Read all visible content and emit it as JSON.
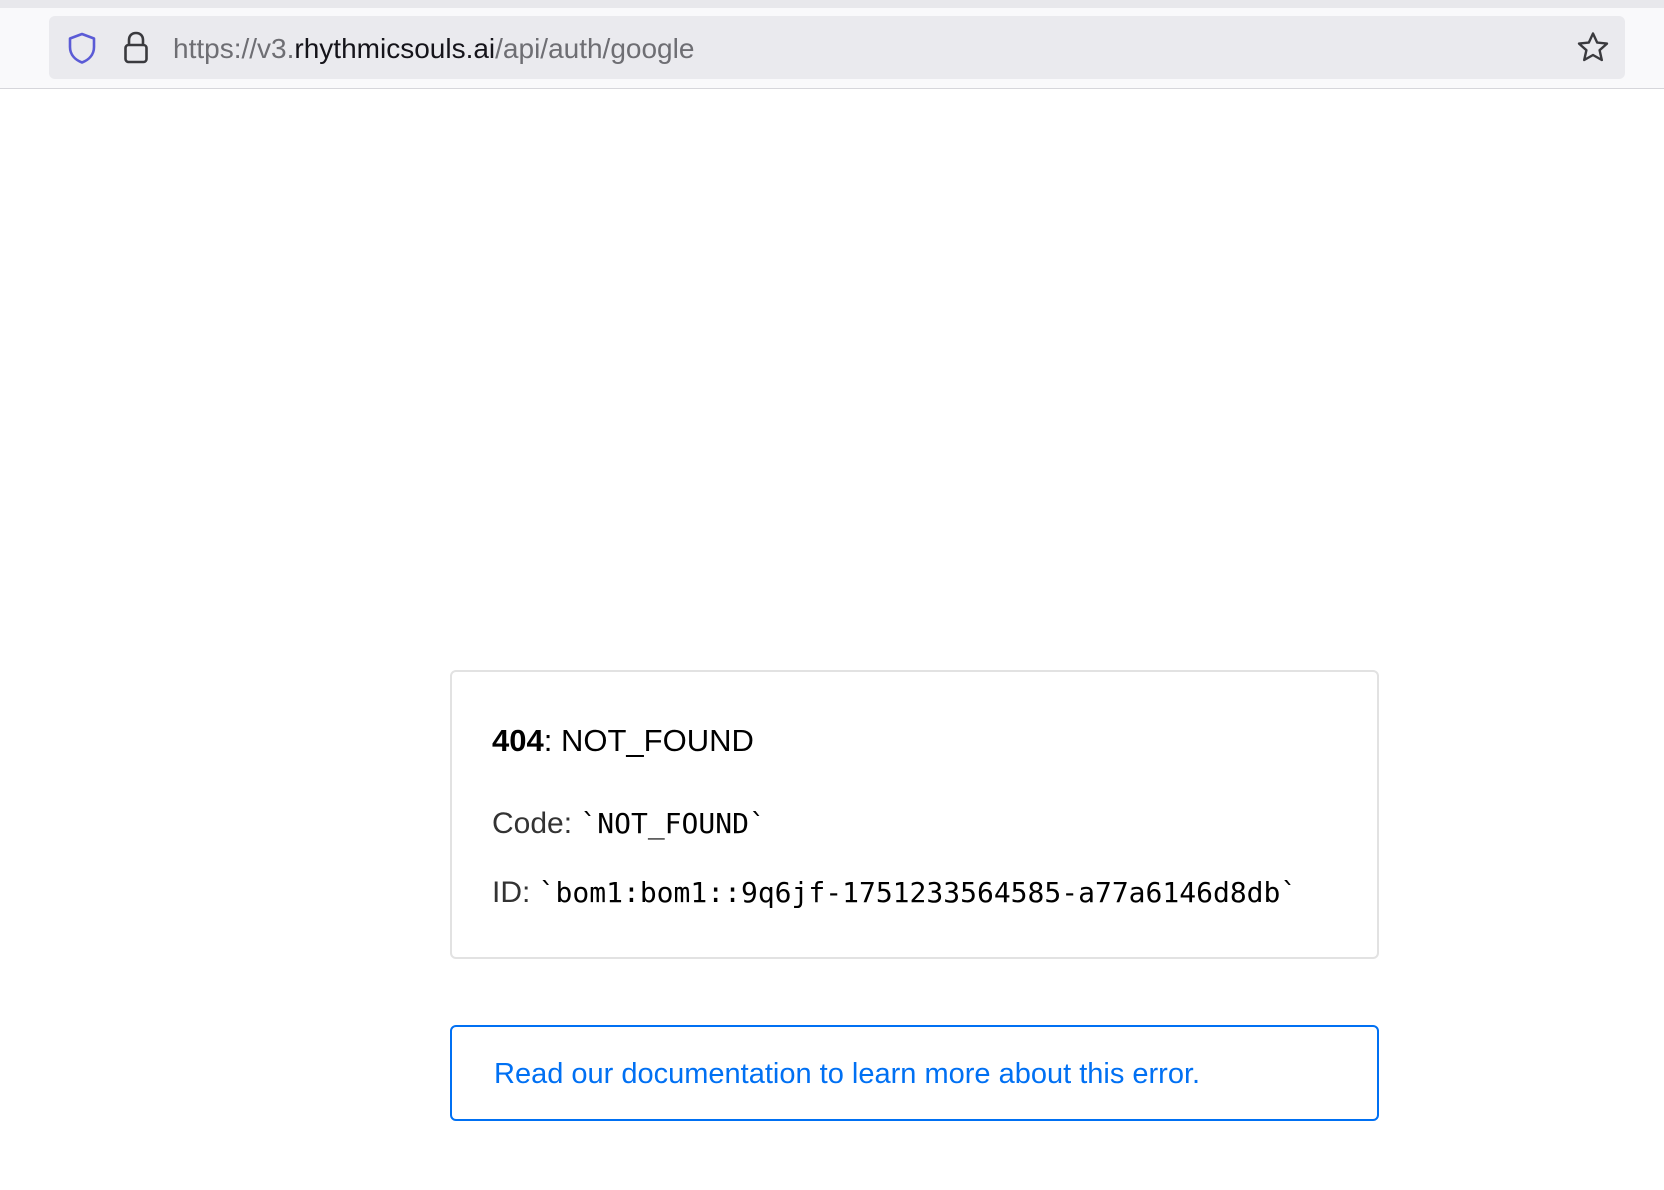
{
  "browser": {
    "url": {
      "prefix": "https://v3.",
      "host": "rhythmicsouls.ai",
      "path": "/api/auth/google"
    },
    "icons": {
      "tracking_protection": "shield-icon",
      "site_security": "lock-icon",
      "bookmark": "star-icon"
    },
    "colors": {
      "shield": "#5b5bd6",
      "url_dim": "#6e6e73",
      "url_host": "#15141a"
    }
  },
  "error": {
    "status_code": "404",
    "status_separator": ": ",
    "status_text": "NOT_FOUND",
    "code_label": "Code: ",
    "code_value": "`NOT_FOUND`",
    "id_label": "ID: ",
    "id_value": "`bom1:bom1::9q6jf-1751233564585-a77a6146d8db`"
  },
  "docs": {
    "link_text": "Read our documentation to learn more about this error.",
    "color": "#0070f3"
  }
}
